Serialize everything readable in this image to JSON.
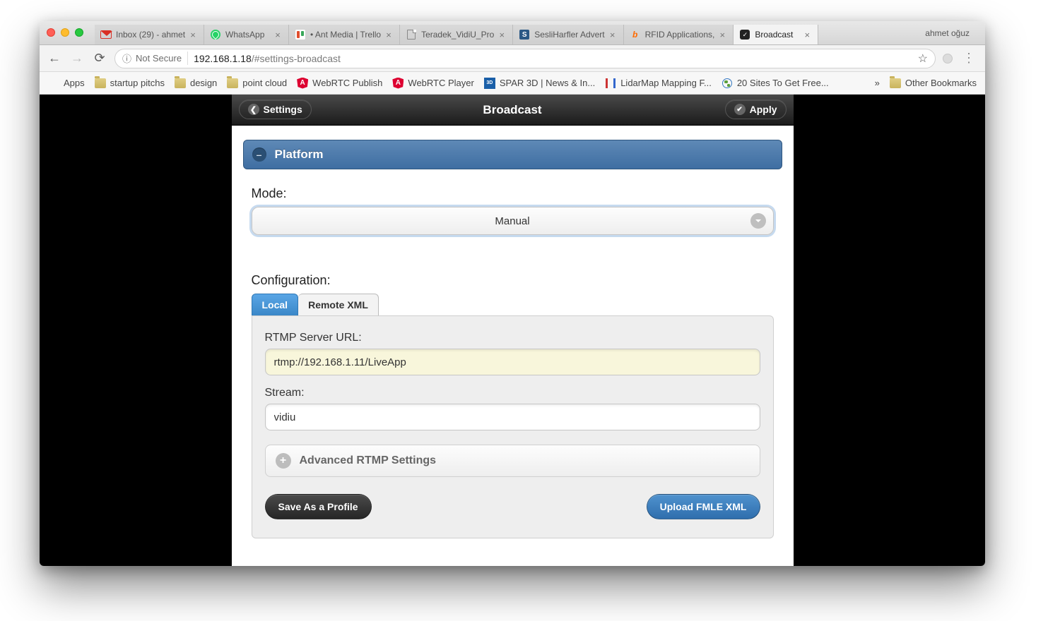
{
  "profile_name": "ahmet oğuz",
  "tabs": [
    {
      "label": "Inbox (29) - ahmet",
      "icon": "gmail"
    },
    {
      "label": "WhatsApp",
      "icon": "whatsapp"
    },
    {
      "label": "• Ant Media | Trello",
      "icon": "trello"
    },
    {
      "label": "Teradek_VidiU_Pro",
      "icon": "doc"
    },
    {
      "label": "SesliHarfler Advert",
      "icon": "s"
    },
    {
      "label": "RFID Applications,",
      "icon": "b"
    },
    {
      "label": "Broadcast",
      "icon": "broadcast",
      "active": true
    }
  ],
  "omnibox": {
    "insecure_label": "Not Secure",
    "host": "192.168.1.18",
    "path": "/#settings-broadcast"
  },
  "bookmarks": {
    "apps": "Apps",
    "items": [
      {
        "label": "startup pitchs",
        "icon": "folder"
      },
      {
        "label": "design",
        "icon": "folder"
      },
      {
        "label": "point cloud",
        "icon": "folder"
      },
      {
        "label": "WebRTC Publish",
        "icon": "angular"
      },
      {
        "label": "WebRTC Player",
        "icon": "angular"
      },
      {
        "label": "SPAR 3D | News & In...",
        "icon": "spar"
      },
      {
        "label": "LidarMap Mapping F...",
        "icon": "lidar"
      },
      {
        "label": "20 Sites To Get Free...",
        "icon": "globe"
      }
    ],
    "overflow": "»",
    "other": "Other Bookmarks"
  },
  "app": {
    "back_label": "Settings",
    "title": "Broadcast",
    "apply_label": "Apply",
    "panel_title": "Platform",
    "mode_label": "Mode:",
    "mode_value": "Manual",
    "config_label": "Configuration:",
    "config_tabs": {
      "local": "Local",
      "remote": "Remote XML"
    },
    "rtmp_label": "RTMP Server URL:",
    "rtmp_value": "rtmp://192.168.1.11/LiveApp",
    "stream_label": "Stream:",
    "stream_value": "vidiu",
    "advanced_label": "Advanced RTMP Settings",
    "save_profile": "Save As a Profile",
    "upload_xml": "Upload FMLE XML"
  }
}
